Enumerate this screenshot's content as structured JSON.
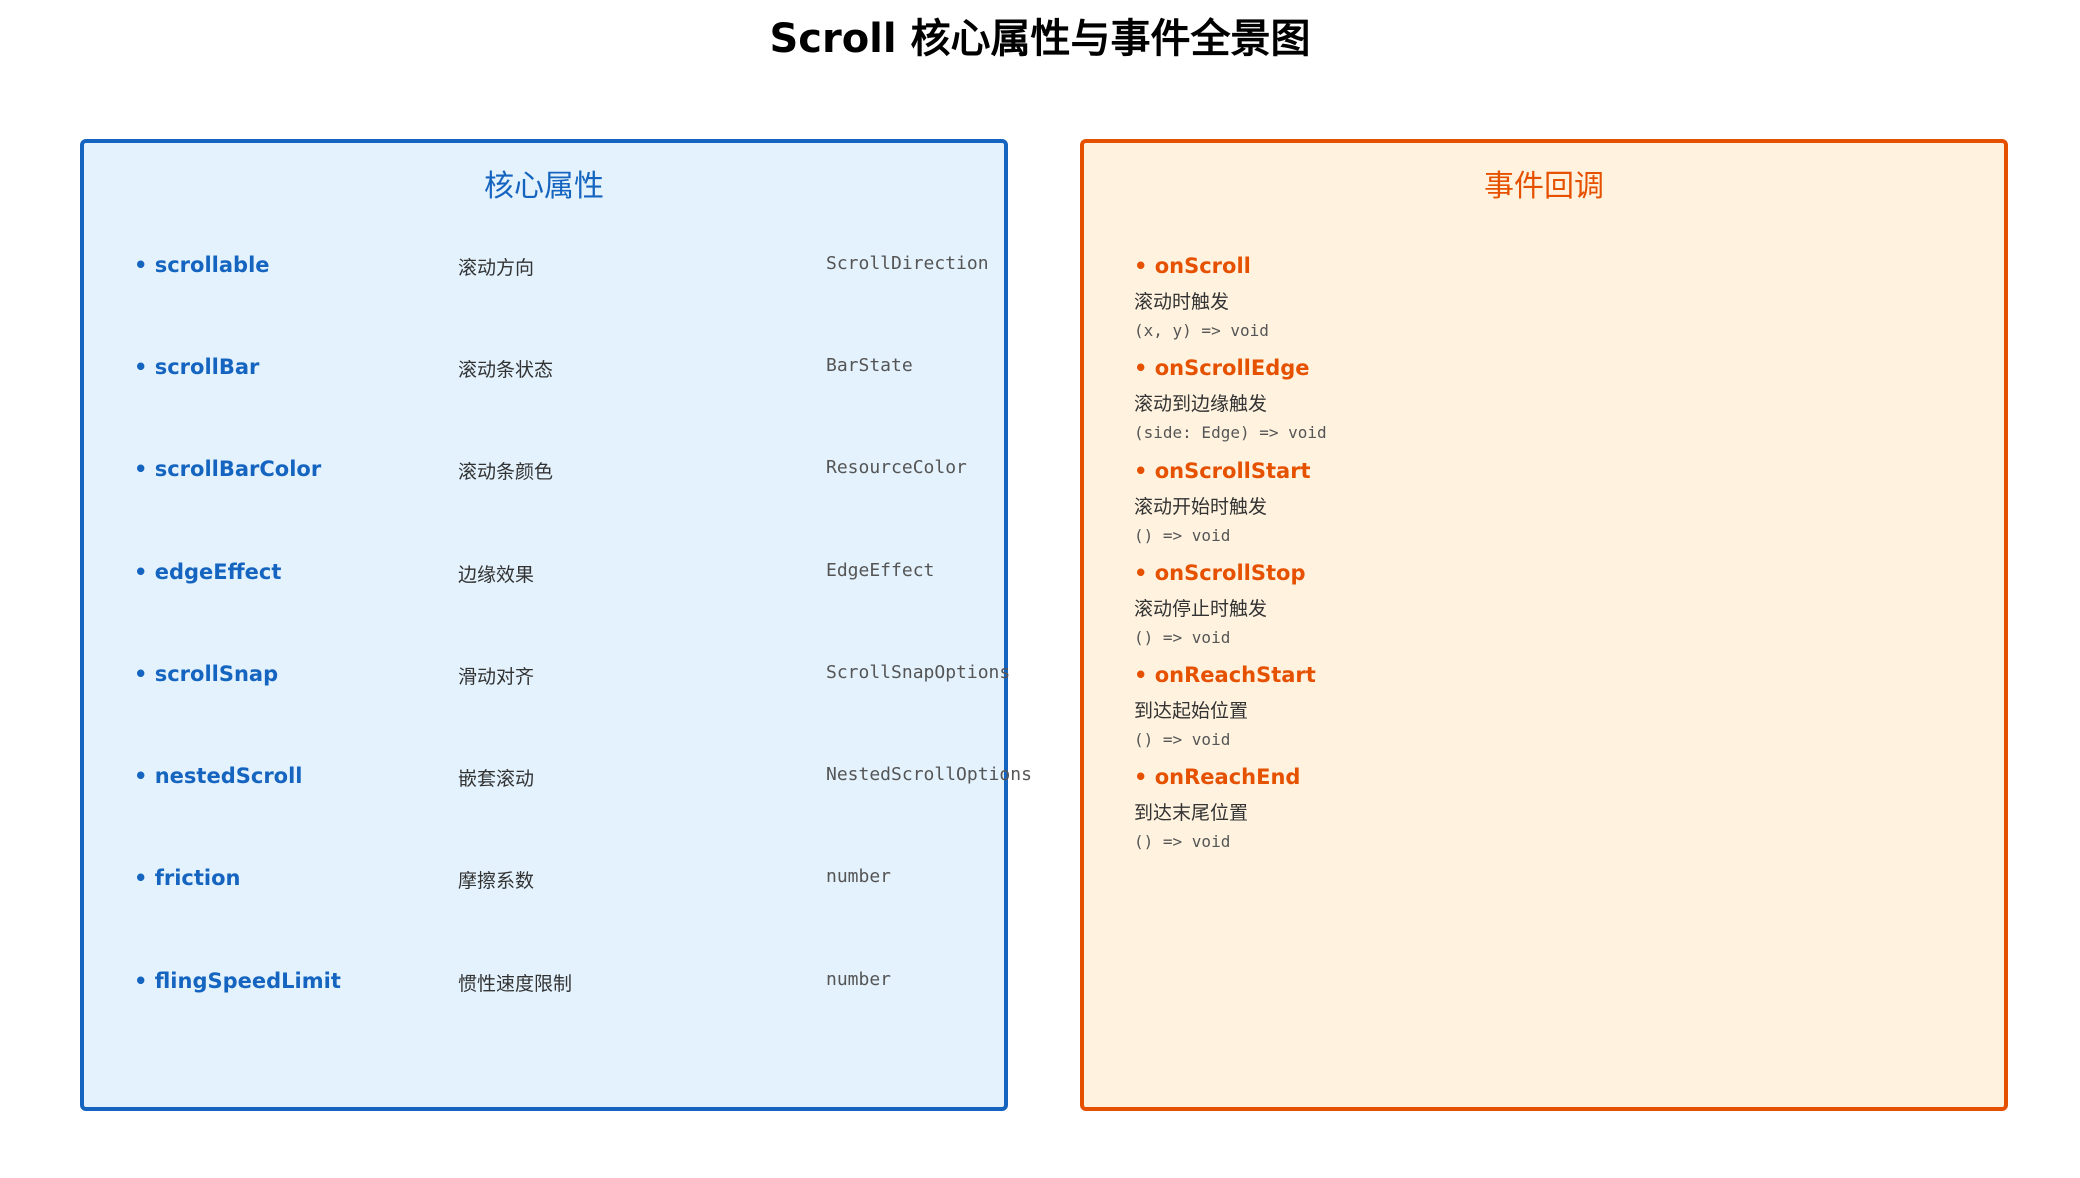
{
  "title": "Scroll 核心属性与事件全景图",
  "properties_panel": {
    "title": "核心属性",
    "items": [
      {
        "name": "scrollable",
        "desc": "滚动方向",
        "type": "ScrollDirection"
      },
      {
        "name": "scrollBar",
        "desc": "滚动条状态",
        "type": "BarState"
      },
      {
        "name": "scrollBarColor",
        "desc": "滚动条颜色",
        "type": "ResourceColor"
      },
      {
        "name": "edgeEffect",
        "desc": "边缘效果",
        "type": "EdgeEffect"
      },
      {
        "name": "scrollSnap",
        "desc": "滑动对齐",
        "type": "ScrollSnapOptions"
      },
      {
        "name": "nestedScroll",
        "desc": "嵌套滚动",
        "type": "NestedScrollOptions"
      },
      {
        "name": "friction",
        "desc": "摩擦系数",
        "type": "number"
      },
      {
        "name": "flingSpeedLimit",
        "desc": "惯性速度限制",
        "type": "number"
      }
    ]
  },
  "events_panel": {
    "title": "事件回调",
    "items": [
      {
        "name": "onScroll",
        "desc": "滚动时触发",
        "signature": "(x, y) => void"
      },
      {
        "name": "onScrollEdge",
        "desc": "滚动到边缘触发",
        "signature": "(side: Edge) => void"
      },
      {
        "name": "onScrollStart",
        "desc": "滚动开始时触发",
        "signature": "() => void"
      },
      {
        "name": "onScrollStop",
        "desc": "滚动停止时触发",
        "signature": "() => void"
      },
      {
        "name": "onReachStart",
        "desc": "到达起始位置",
        "signature": "() => void"
      },
      {
        "name": "onReachEnd",
        "desc": "到达末尾位置",
        "signature": "() => void"
      }
    ]
  },
  "colors": {
    "properties_accent": "#1565c0",
    "properties_bg": "#e3f2fd",
    "events_accent": "#e65100",
    "events_bg": "#fff3e0"
  }
}
